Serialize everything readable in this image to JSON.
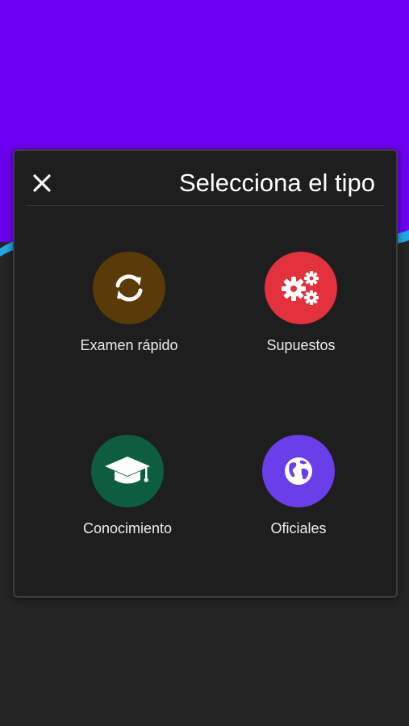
{
  "dialog": {
    "title": "Selecciona el tipo",
    "close_icon": "close-icon"
  },
  "options": [
    {
      "label": "Examen rápido",
      "icon": "refresh-icon",
      "color": "#5a3a08"
    },
    {
      "label": "Supuestos",
      "icon": "gears-icon",
      "color": "#e3323d"
    },
    {
      "label": "Conocimiento",
      "icon": "graduation-cap-icon",
      "color": "#0d5e3f"
    },
    {
      "label": "Oficiales",
      "icon": "globe-icon",
      "color": "#6a3ee8"
    }
  ],
  "colors": {
    "header_band": "#6d00f0",
    "accent_wave": "#1fa7e6",
    "background": "#252525",
    "dialog": "#1e1e1e"
  }
}
